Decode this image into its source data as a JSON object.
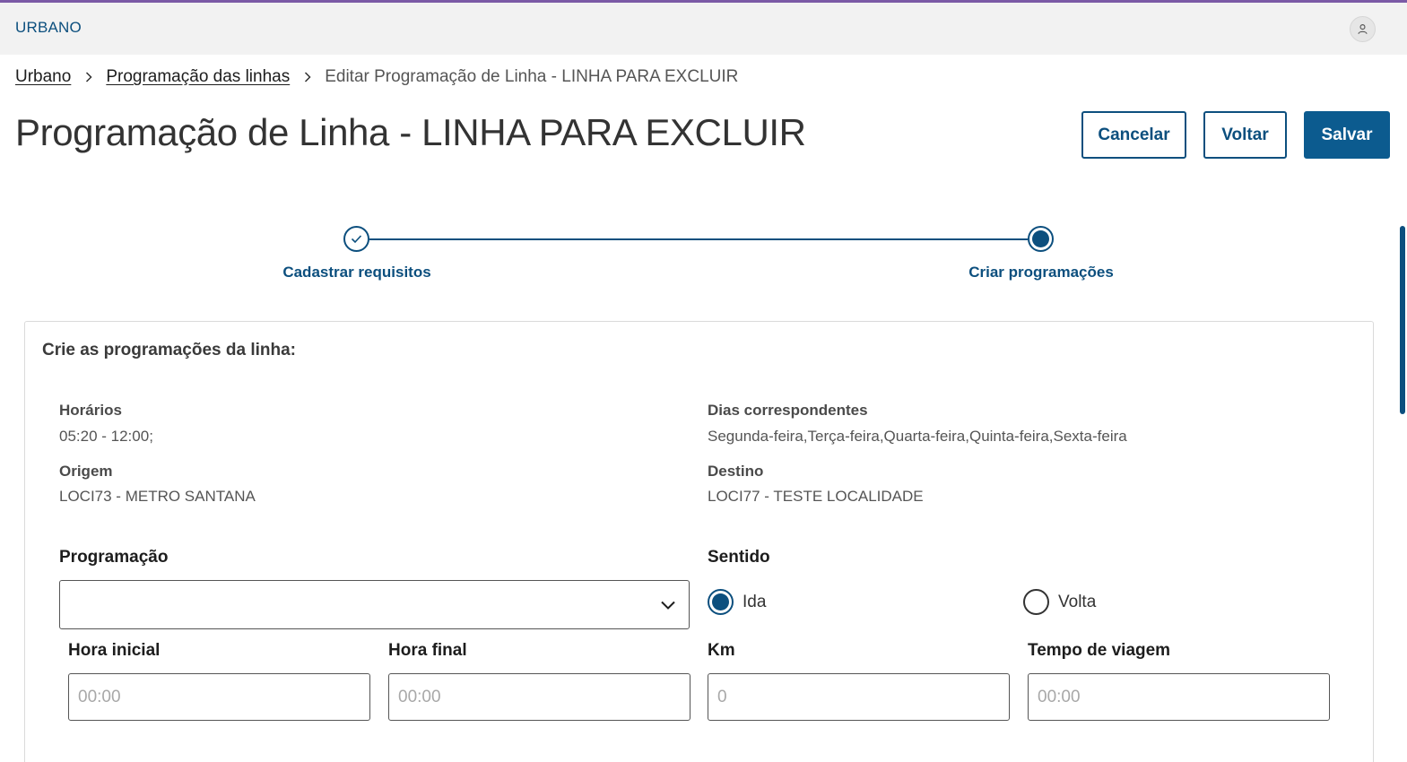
{
  "header": {
    "brand": "URBANO",
    "user_icon": "user-icon"
  },
  "breadcrumb": {
    "items": [
      "Urbano",
      "Programação das linhas"
    ],
    "current": "Editar Programação de Linha - LINHA PARA EXCLUIR",
    "separator_icon": "chevron-right-icon"
  },
  "page": {
    "title": "Programação de Linha - LINHA PARA EXCLUIR"
  },
  "actions": {
    "cancel_label": "Cancelar",
    "back_label": "Voltar",
    "save_label": "Salvar"
  },
  "stepper": {
    "steps": [
      {
        "label": "Cadastrar requisitos",
        "state": "completed",
        "icon": "check-icon"
      },
      {
        "label": "Criar programações",
        "state": "active"
      }
    ]
  },
  "card": {
    "title": "Crie as programações da linha:",
    "info": {
      "horarios_label": "Horários",
      "horarios_value": "05:20 - 12:00;",
      "dias_label": "Dias correspondentes",
      "dias_value": "Segunda-feira,Terça-feira,Quarta-feira,Quinta-feira,Sexta-feira",
      "origem_label": "Origem",
      "origem_value": "LOCI73 - METRO SANTANA",
      "destino_label": "Destino",
      "destino_value": "LOCI77 - TESTE LOCALIDADE"
    },
    "form": {
      "programacao_label": "Programação",
      "programacao_value": "",
      "sentido_label": "Sentido",
      "sentido_options": [
        {
          "label": "Ida",
          "checked": true
        },
        {
          "label": "Volta",
          "checked": false
        }
      ],
      "hora_inicial_label": "Hora inicial",
      "hora_inicial_placeholder": "00:00",
      "hora_final_label": "Hora final",
      "hora_final_placeholder": "00:00",
      "km_label": "Km",
      "km_placeholder": "0",
      "tempo_label": "Tempo de viagem",
      "tempo_placeholder": "00:00"
    }
  },
  "colors": {
    "primary": "#0c4f7e",
    "top_accent": "#7b5aa6",
    "header_bg": "#f2f2f2"
  }
}
